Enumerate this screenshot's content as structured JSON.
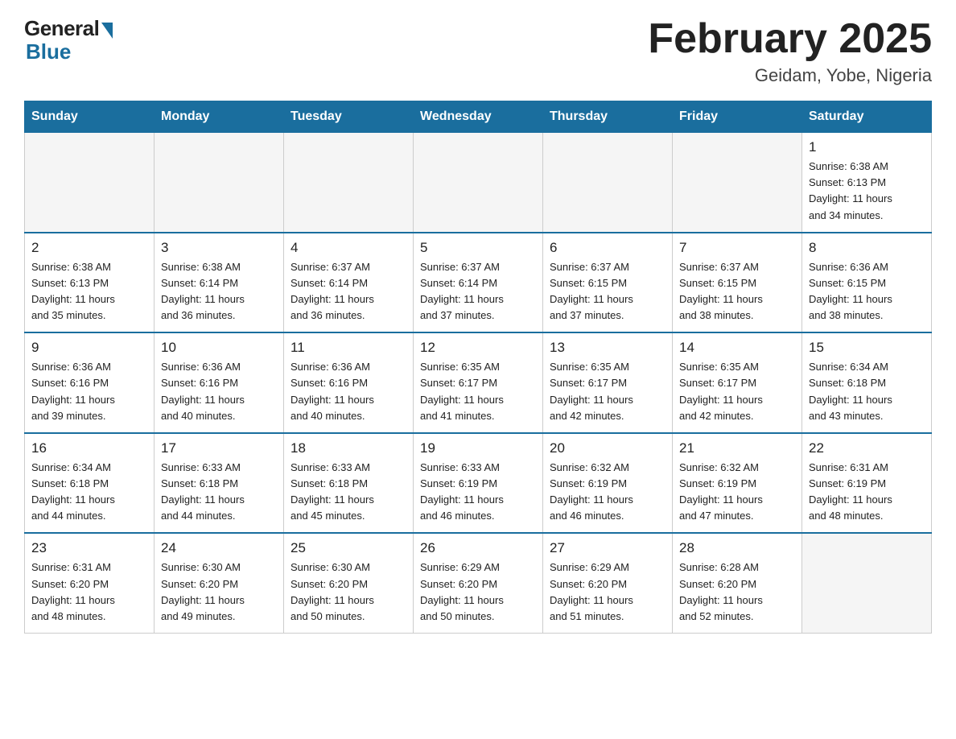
{
  "logo": {
    "general": "General",
    "blue": "Blue"
  },
  "title": "February 2025",
  "location": "Geidam, Yobe, Nigeria",
  "days_of_week": [
    "Sunday",
    "Monday",
    "Tuesday",
    "Wednesday",
    "Thursday",
    "Friday",
    "Saturday"
  ],
  "weeks": [
    [
      {
        "day": "",
        "info": ""
      },
      {
        "day": "",
        "info": ""
      },
      {
        "day": "",
        "info": ""
      },
      {
        "day": "",
        "info": ""
      },
      {
        "day": "",
        "info": ""
      },
      {
        "day": "",
        "info": ""
      },
      {
        "day": "1",
        "info": "Sunrise: 6:38 AM\nSunset: 6:13 PM\nDaylight: 11 hours\nand 34 minutes."
      }
    ],
    [
      {
        "day": "2",
        "info": "Sunrise: 6:38 AM\nSunset: 6:13 PM\nDaylight: 11 hours\nand 35 minutes."
      },
      {
        "day": "3",
        "info": "Sunrise: 6:38 AM\nSunset: 6:14 PM\nDaylight: 11 hours\nand 36 minutes."
      },
      {
        "day": "4",
        "info": "Sunrise: 6:37 AM\nSunset: 6:14 PM\nDaylight: 11 hours\nand 36 minutes."
      },
      {
        "day": "5",
        "info": "Sunrise: 6:37 AM\nSunset: 6:14 PM\nDaylight: 11 hours\nand 37 minutes."
      },
      {
        "day": "6",
        "info": "Sunrise: 6:37 AM\nSunset: 6:15 PM\nDaylight: 11 hours\nand 37 minutes."
      },
      {
        "day": "7",
        "info": "Sunrise: 6:37 AM\nSunset: 6:15 PM\nDaylight: 11 hours\nand 38 minutes."
      },
      {
        "day": "8",
        "info": "Sunrise: 6:36 AM\nSunset: 6:15 PM\nDaylight: 11 hours\nand 38 minutes."
      }
    ],
    [
      {
        "day": "9",
        "info": "Sunrise: 6:36 AM\nSunset: 6:16 PM\nDaylight: 11 hours\nand 39 minutes."
      },
      {
        "day": "10",
        "info": "Sunrise: 6:36 AM\nSunset: 6:16 PM\nDaylight: 11 hours\nand 40 minutes."
      },
      {
        "day": "11",
        "info": "Sunrise: 6:36 AM\nSunset: 6:16 PM\nDaylight: 11 hours\nand 40 minutes."
      },
      {
        "day": "12",
        "info": "Sunrise: 6:35 AM\nSunset: 6:17 PM\nDaylight: 11 hours\nand 41 minutes."
      },
      {
        "day": "13",
        "info": "Sunrise: 6:35 AM\nSunset: 6:17 PM\nDaylight: 11 hours\nand 42 minutes."
      },
      {
        "day": "14",
        "info": "Sunrise: 6:35 AM\nSunset: 6:17 PM\nDaylight: 11 hours\nand 42 minutes."
      },
      {
        "day": "15",
        "info": "Sunrise: 6:34 AM\nSunset: 6:18 PM\nDaylight: 11 hours\nand 43 minutes."
      }
    ],
    [
      {
        "day": "16",
        "info": "Sunrise: 6:34 AM\nSunset: 6:18 PM\nDaylight: 11 hours\nand 44 minutes."
      },
      {
        "day": "17",
        "info": "Sunrise: 6:33 AM\nSunset: 6:18 PM\nDaylight: 11 hours\nand 44 minutes."
      },
      {
        "day": "18",
        "info": "Sunrise: 6:33 AM\nSunset: 6:18 PM\nDaylight: 11 hours\nand 45 minutes."
      },
      {
        "day": "19",
        "info": "Sunrise: 6:33 AM\nSunset: 6:19 PM\nDaylight: 11 hours\nand 46 minutes."
      },
      {
        "day": "20",
        "info": "Sunrise: 6:32 AM\nSunset: 6:19 PM\nDaylight: 11 hours\nand 46 minutes."
      },
      {
        "day": "21",
        "info": "Sunrise: 6:32 AM\nSunset: 6:19 PM\nDaylight: 11 hours\nand 47 minutes."
      },
      {
        "day": "22",
        "info": "Sunrise: 6:31 AM\nSunset: 6:19 PM\nDaylight: 11 hours\nand 48 minutes."
      }
    ],
    [
      {
        "day": "23",
        "info": "Sunrise: 6:31 AM\nSunset: 6:20 PM\nDaylight: 11 hours\nand 48 minutes."
      },
      {
        "day": "24",
        "info": "Sunrise: 6:30 AM\nSunset: 6:20 PM\nDaylight: 11 hours\nand 49 minutes."
      },
      {
        "day": "25",
        "info": "Sunrise: 6:30 AM\nSunset: 6:20 PM\nDaylight: 11 hours\nand 50 minutes."
      },
      {
        "day": "26",
        "info": "Sunrise: 6:29 AM\nSunset: 6:20 PM\nDaylight: 11 hours\nand 50 minutes."
      },
      {
        "day": "27",
        "info": "Sunrise: 6:29 AM\nSunset: 6:20 PM\nDaylight: 11 hours\nand 51 minutes."
      },
      {
        "day": "28",
        "info": "Sunrise: 6:28 AM\nSunset: 6:20 PM\nDaylight: 11 hours\nand 52 minutes."
      },
      {
        "day": "",
        "info": ""
      }
    ]
  ]
}
